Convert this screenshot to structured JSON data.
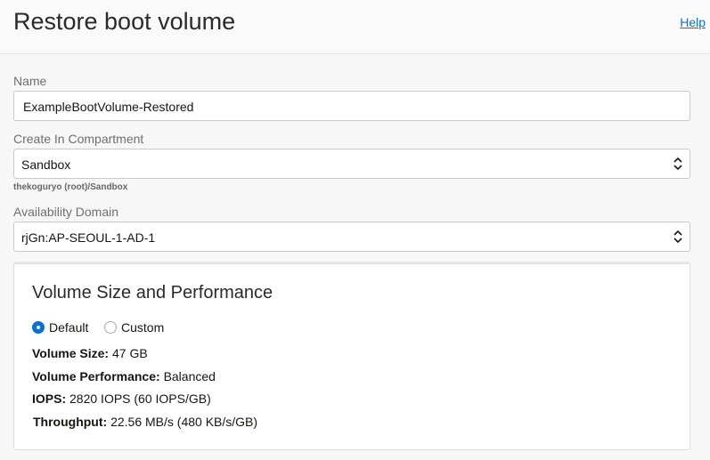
{
  "header": {
    "title": "Restore boot volume",
    "help": "Help"
  },
  "form": {
    "name_label": "Name",
    "name_value": "ExampleBootVolume-Restored",
    "compartment_label": "Create In Compartment",
    "compartment_value": "Sandbox",
    "compartment_path": "thekoguryo (root)/Sandbox",
    "ad_label": "Availability Domain",
    "ad_value": "rjGn:AP-SEOUL-1-AD-1"
  },
  "panel": {
    "title": "Volume Size and Performance",
    "options": [
      "Default",
      "Custom"
    ],
    "selected": "Default",
    "rows": [
      {
        "label": "Volume Size:",
        "value": "47 GB"
      },
      {
        "label": "Volume Performance:",
        "value": "Balanced"
      },
      {
        "label": "IOPS:",
        "value": "2820 IOPS (60 IOPS/GB)"
      },
      {
        "label": "Throughput:",
        "value": "22.56 MB/s (480 KB/s/GB)"
      }
    ]
  }
}
